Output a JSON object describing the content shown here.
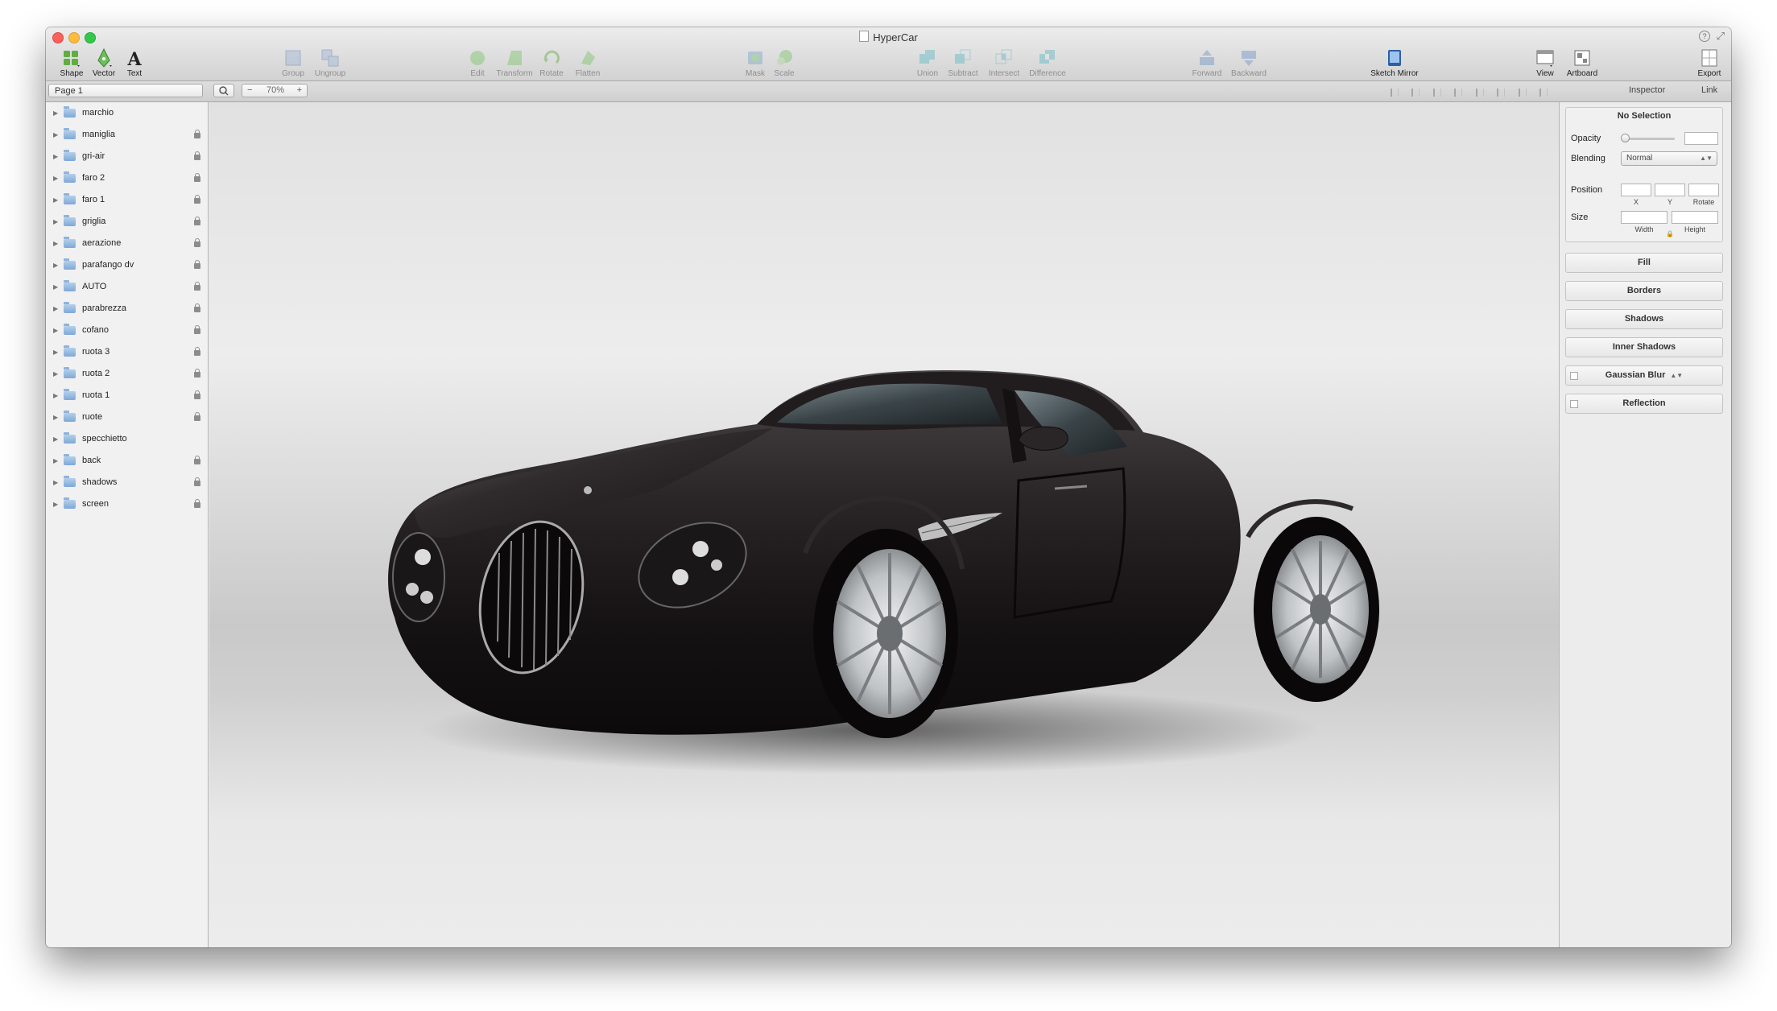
{
  "window": {
    "title": "HyperCar"
  },
  "toolbar": {
    "shape": "Shape",
    "vector": "Vector",
    "text": "Text",
    "group": "Group",
    "ungroup": "Ungroup",
    "edit": "Edit",
    "transform": "Transform",
    "rotate": "Rotate",
    "flatten": "Flatten",
    "mask": "Mask",
    "scale": "Scale",
    "union": "Union",
    "subtract": "Subtract",
    "intersect": "Intersect",
    "difference": "Difference",
    "forward": "Forward",
    "backward": "Backward",
    "sketch_mirror": "Sketch Mirror",
    "view": "View",
    "artboard": "Artboard",
    "export": "Export"
  },
  "subbar": {
    "page": "Page 1",
    "zoom_minus": "−",
    "zoom_value": "70%",
    "zoom_plus": "+",
    "inspector_tab": "Inspector",
    "link_tab": "Link"
  },
  "layers": [
    {
      "name": "marchio",
      "locked": false
    },
    {
      "name": "maniglia",
      "locked": true
    },
    {
      "name": "gri-air",
      "locked": true
    },
    {
      "name": "faro 2",
      "locked": true
    },
    {
      "name": "faro 1",
      "locked": true
    },
    {
      "name": "griglia",
      "locked": true
    },
    {
      "name": "aerazione",
      "locked": true
    },
    {
      "name": "parafango dv",
      "locked": true
    },
    {
      "name": "AUTO",
      "locked": true
    },
    {
      "name": "parabrezza",
      "locked": true
    },
    {
      "name": "cofano",
      "locked": true
    },
    {
      "name": "ruota 3",
      "locked": true
    },
    {
      "name": "ruota 2",
      "locked": true
    },
    {
      "name": "ruota 1",
      "locked": true
    },
    {
      "name": "ruote",
      "locked": true
    },
    {
      "name": "specchietto",
      "locked": false
    },
    {
      "name": "back",
      "locked": true
    },
    {
      "name": "shadows",
      "locked": true
    },
    {
      "name": "screen",
      "locked": true
    }
  ],
  "inspector": {
    "no_selection": "No Selection",
    "opacity_label": "Opacity",
    "opacity_value": "",
    "blending_label": "Blending",
    "blending_value": "Normal",
    "position_label": "Position",
    "x_label": "X",
    "y_label": "Y",
    "rotate_label": "Rotate",
    "size_label": "Size",
    "width_label": "Width",
    "height_label": "Height",
    "fill": "Fill",
    "borders": "Borders",
    "shadows": "Shadows",
    "inner_shadows": "Inner Shadows",
    "gaussian_blur": "Gaussian Blur",
    "reflection": "Reflection"
  },
  "colors": {
    "car_body": "#1e1a1c",
    "canvas_bg": "#e3e3e3",
    "folder": "#8fb3dc"
  }
}
